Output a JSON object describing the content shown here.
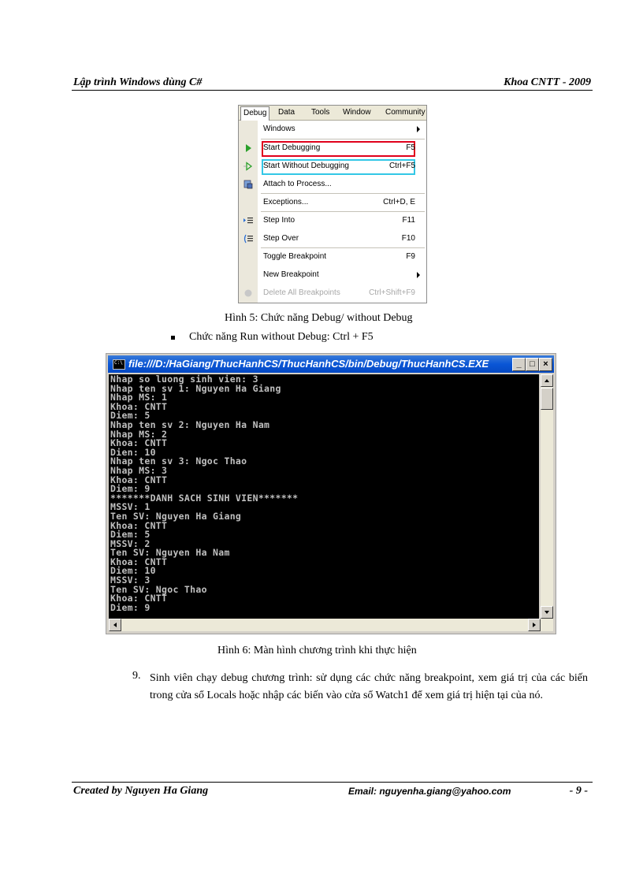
{
  "header": {
    "left": "Lập trình Windows dùng C#",
    "right": "Khoa CNTT - 2009"
  },
  "menu": {
    "bar": [
      "Debug",
      "Data",
      "Tools",
      "Window",
      "Community"
    ],
    "items": [
      {
        "label": "Windows",
        "shortcut": "",
        "submenu": true
      },
      {
        "label": "Start Debugging",
        "shortcut": "F5",
        "icon": "play-icon"
      },
      {
        "label": "Start Without Debugging",
        "shortcut": "Ctrl+F5",
        "icon": "play-outline-icon"
      },
      {
        "label": "Attach to Process...",
        "shortcut": "",
        "icon": "attach-process-icon"
      },
      {
        "label": "Exceptions...",
        "shortcut": "Ctrl+D, E"
      },
      {
        "label": "Step Into",
        "shortcut": "F11",
        "icon": "step-into-icon"
      },
      {
        "label": "Step Over",
        "shortcut": "F10",
        "icon": "step-over-icon"
      },
      {
        "label": "Toggle Breakpoint",
        "shortcut": "F9"
      },
      {
        "label": "New Breakpoint",
        "shortcut": "",
        "submenu": true
      },
      {
        "label": "Delete All Breakpoints",
        "shortcut": "Ctrl+Shift+F9",
        "disabled": true
      }
    ],
    "highlight_colors": {
      "start_debugging": "#e0001b",
      "start_without_debugging": "#33c7e6"
    }
  },
  "caption5": "Hình 5: Chức năng Debug/ without Debug",
  "bullet_text": "Chức năng Run without Debug: Ctrl + F5",
  "console": {
    "title": "file:///D:/HaGiang/ThucHanhCS/ThucHanhCS/bin/Debug/ThucHanhCS.EXE",
    "lines": [
      "Nhap so luong sinh vien: 3",
      "Nhap ten sv 1: Nguyen Ha Giang",
      "Nhap MS: 1",
      "Khoa: CNTT",
      "Diem: 5",
      "Nhap ten sv 2: Nguyen Ha Nam",
      "Nhap MS: 2",
      "Khoa: CNTT",
      "Dien: 10",
      "Nhap ten sv 3: Ngoc Thao",
      "Nhap MS: 3",
      "Khoa: CNTT",
      "Diem: 9",
      "*******DANH SACH SINH VIEN*******",
      "MSSV: 1",
      "Ten SV: Nguyen Ha Giang",
      "Khoa: CNTT",
      "Diem: 5",
      "MSSV: 2",
      "Ten SV: Nguyen Ha Nam",
      "Khoa: CNTT",
      "Diem: 10",
      "MSSV: 3",
      "Ten SV: Ngoc Thao",
      "Khoa: CNTT",
      "Diem: 9"
    ],
    "buttons": {
      "minimize": "_",
      "maximize": "□",
      "close": "×"
    }
  },
  "caption6": "Hình 6: Màn hình chương trình khi thực hiện",
  "step": {
    "number": "9.",
    "text": "Sinh viên chạy debug chương trình: sử dụng các chức năng breakpoint, xem giá trị của các biến trong cửa sổ Locals hoặc nhập các biến vào cửa sổ Watch1 để xem giá trị hiện tại của nó."
  },
  "footer": {
    "left": "Created by Nguyen Ha Giang",
    "email": "Email: nguyenha.giang@yahoo.com",
    "page": "- 9 -"
  }
}
